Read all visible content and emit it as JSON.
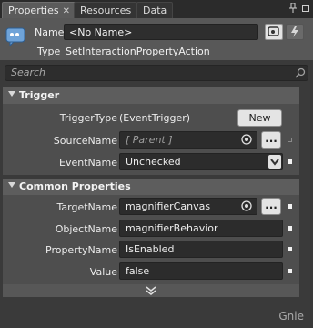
{
  "tabs": [
    {
      "label": "Properties",
      "active": true,
      "closable": true
    },
    {
      "label": "Resources",
      "active": false
    },
    {
      "label": "Data",
      "active": false
    }
  ],
  "tab_icons": [
    "pin-icon",
    "panel-close-icon"
  ],
  "header": {
    "name_label": "Name",
    "name_value": "<No Name>",
    "type_label": "Type",
    "type_value": "SetInteractionPropertyAction"
  },
  "search": {
    "placeholder": "Search"
  },
  "trigger": {
    "title": "Trigger",
    "trigger_type_label": "TriggerType",
    "trigger_type_value": "(EventTrigger)",
    "new_button": "New",
    "source_name_label": "SourceName",
    "source_name_value": "[ Parent ]",
    "event_name_label": "EventName",
    "event_name_value": "Unchecked"
  },
  "common": {
    "title": "Common Properties",
    "target_name_label": "TargetName",
    "target_name_value": "magnifierCanvas",
    "object_name_label": "ObjectName",
    "object_name_value": "magnifierBehavior",
    "property_name_label": "PropertyName",
    "property_name_value": "IsEnabled",
    "value_label": "Value",
    "value_value": "false"
  },
  "browse_button": "...",
  "watermark": "Gnie",
  "colors": {
    "panel": "#4e4e4e",
    "header": "#585858",
    "field": "#2c2c2c"
  }
}
